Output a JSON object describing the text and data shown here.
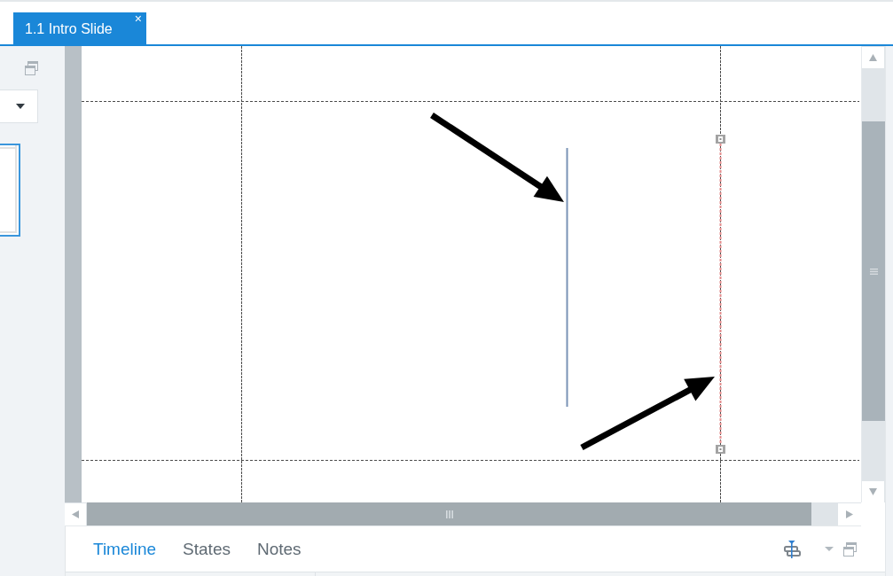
{
  "document_tabs": [
    {
      "label": "1.1 Intro Slide",
      "selected": true,
      "close_glyph": "×"
    }
  ],
  "slide_thumbnails": [
    {
      "selected": true
    }
  ],
  "slide_objects": [
    {
      "kind": "line"
    },
    {
      "kind": "selected_line"
    },
    {
      "kind": "arrow"
    },
    {
      "kind": "arrow"
    }
  ],
  "panel_tabs": [
    {
      "label": "Timeline",
      "selected": true
    },
    {
      "label": "States",
      "selected": false
    },
    {
      "label": "Notes",
      "selected": false
    }
  ]
}
